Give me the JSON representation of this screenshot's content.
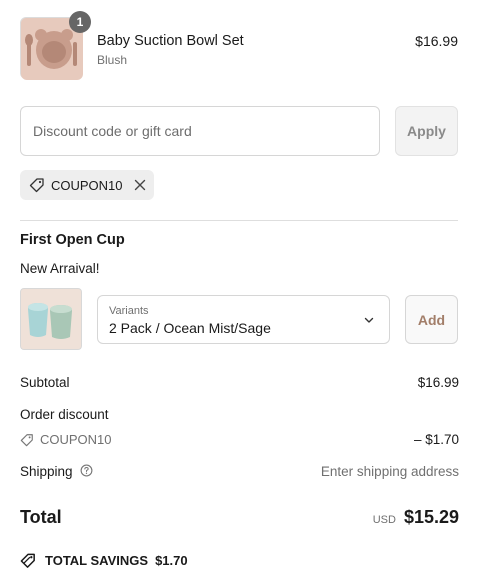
{
  "line_item": {
    "quantity": "1",
    "title": "Baby Suction Bowl Set",
    "variant": "Blush",
    "price": "$16.99",
    "thumbnail_icon": "suction-bowl-set-image"
  },
  "discount": {
    "placeholder": "Discount code or gift card",
    "apply_label": "Apply",
    "applied_code": "COUPON10",
    "tag_icon": "tag-icon",
    "remove_icon": "close-icon"
  },
  "upsell": {
    "heading": "First Open Cup",
    "subheading": "New Arraival!",
    "thumbnail_icon": "open-cup-image",
    "variants_label": "Variants",
    "selected_variant": "2 Pack / Ocean Mist/Sage",
    "add_label": "Add"
  },
  "summary": {
    "subtotal_label": "Subtotal",
    "subtotal_value": "$16.99",
    "order_discount_label": "Order discount",
    "discount_code": "COUPON10",
    "discount_value": "– $1.70",
    "shipping_label": "Shipping",
    "shipping_value": "Enter shipping address",
    "total_label": "Total",
    "currency": "USD",
    "total_value": "$15.29",
    "savings_label": "TOTAL SAVINGS",
    "savings_value": "$1.70"
  },
  "colors": {
    "accent_text": "#a27e69",
    "badge": "#666666",
    "muted": "#707070"
  }
}
